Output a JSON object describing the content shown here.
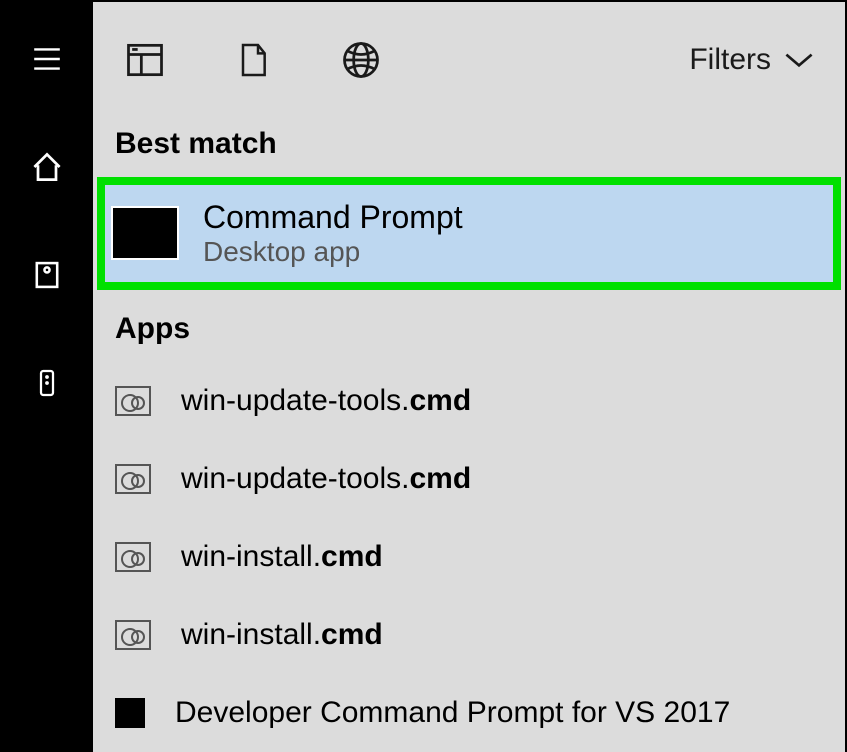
{
  "rail": {
    "items": [
      "hamburger",
      "home",
      "recent",
      "remote"
    ]
  },
  "topbar": {
    "tabs": [
      "apps-tab",
      "documents-tab",
      "web-tab"
    ],
    "filters_label": "Filters"
  },
  "sections": {
    "best_match_header": "Best match",
    "apps_header": "Apps"
  },
  "best_match": {
    "title": "Command Prompt",
    "subtitle": "Desktop app"
  },
  "apps": [
    {
      "prefix": "win-update-tools.",
      "bold": "cmd",
      "icon": "cmd"
    },
    {
      "prefix": "win-update-tools.",
      "bold": "cmd",
      "icon": "cmd"
    },
    {
      "prefix": "win-install.",
      "bold": "cmd",
      "icon": "cmd"
    },
    {
      "prefix": "win-install.",
      "bold": "cmd",
      "icon": "cmd"
    },
    {
      "prefix": "Developer Command Prompt for VS 2017",
      "bold": "",
      "icon": "square"
    }
  ]
}
